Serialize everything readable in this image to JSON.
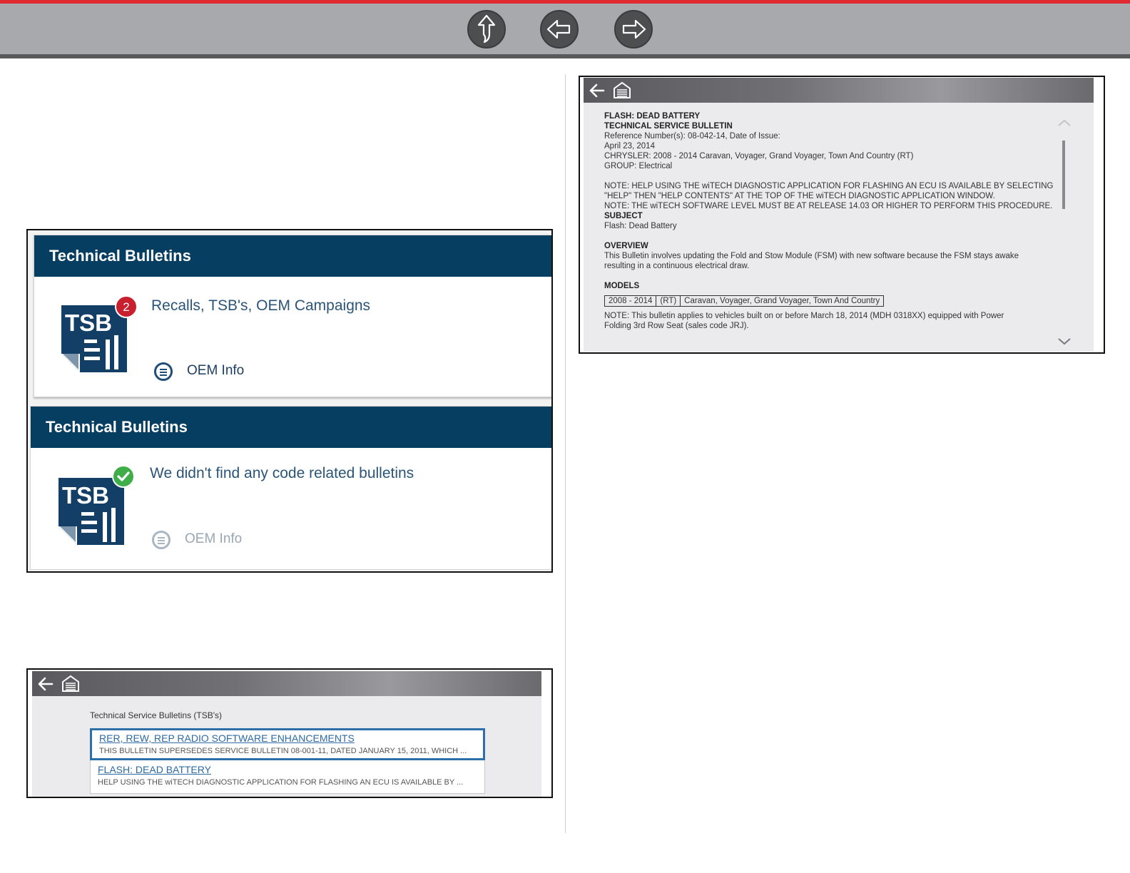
{
  "nav": {
    "buttons": [
      {
        "name": "up-arrow-icon"
      },
      {
        "name": "left-arrow-icon"
      },
      {
        "name": "right-arrow-icon"
      }
    ],
    "colors": {
      "accent": "#e02a2f",
      "bar": "#a7a9ac",
      "button": "#4d4e50"
    }
  },
  "bulletins_panel": {
    "card1": {
      "header": "Technical Bulletins",
      "icon_text": "TSB",
      "badge": "2",
      "message": "Recalls, TSB's, OEM Campaigns",
      "oem_label": "OEM Info"
    },
    "card2": {
      "header": "Technical Bulletins",
      "icon_text": "TSB",
      "message": "We didn't find any code related bulletins",
      "oem_label": "OEM Info"
    },
    "colors": {
      "header": "#063e62",
      "badge": "#c8202e",
      "check": "#3fae49",
      "icon": "#133f67"
    }
  },
  "tsb_list_screen": {
    "title": "Technical Service Bulletins (TSB's)",
    "items": [
      {
        "title": "RER, REW, REP RADIO SOFTWARE ENHANCEMENTS",
        "summary": "THIS BULLETIN SUPERSEDES SERVICE BULLETIN 08-001-11, DATED JANUARY 15, 2011, WHICH ...",
        "selected": true
      },
      {
        "title": "FLASH: DEAD BATTERY",
        "summary": "HELP USING THE wiTECH DIAGNOSTIC APPLICATION FOR FLASHING AN ECU IS AVAILABLE BY ...",
        "selected": false
      }
    ]
  },
  "tsb_detail_screen": {
    "title": "FLASH: DEAD BATTERY",
    "doc_type": "TECHNICAL SERVICE BULLETIN",
    "ref_line": "Reference Number(s): 08-042-14, Date of Issue:",
    "date_line": "April 23, 2014",
    "vehicle_line": "CHRYSLER: 2008 - 2014 Caravan, Voyager, Grand Voyager, Town And Country (RT)",
    "group_line": "GROUP: Electrical",
    "note1_a": "NOTE: HELP USING THE wiTECH DIAGNOSTIC APPLICATION FOR FLASHING AN ECU IS AVAILABLE BY SELECTING",
    "note1_b": "\"HELP\" THEN \"HELP CONTENTS\" AT THE TOP OF THE wiTECH DIAGNOSTIC APPLICATION WINDOW.",
    "note2": "NOTE: THE wiTECH SOFTWARE LEVEL MUST BE AT RELEASE 14.03 OR HIGHER TO PERFORM THIS PROCEDURE.",
    "subject_heading": "SUBJECT",
    "subject_text": "Flash: Dead Battery",
    "overview_heading": "OVERVIEW",
    "overview_a": "This Bulletin involves updating the Fold and Stow Module (FSM) with new software because the FSM stays awake",
    "overview_b": "resulting in a continuous electrical draw.",
    "models_heading": "MODELS",
    "models_row": {
      "years": "2008 - 2014",
      "code": "(RT)",
      "names": "Caravan, Voyager, Grand Voyager, Town And Country"
    },
    "note3_a": "NOTE: This bulletin applies to vehicles built on or before March 18, 2014 (MDH 0318XX) equipped with Power",
    "note3_b": "Folding 3rd Row Seat (sales code JRJ)."
  }
}
